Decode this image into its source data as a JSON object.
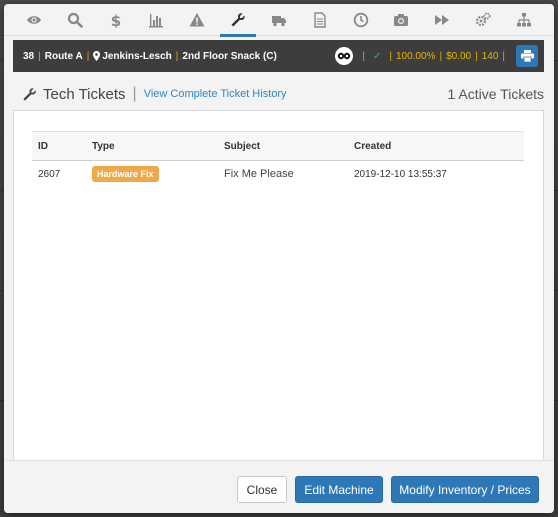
{
  "nav": {
    "icons": [
      "eye-icon",
      "search-icon",
      "dollar-icon",
      "bar-chart-icon",
      "warning-icon",
      "wrench-icon",
      "truck-icon",
      "document-icon",
      "clock-icon",
      "camera-icon",
      "fast-forward-icon",
      "gears-icon",
      "sitemap-icon"
    ],
    "active": "wrench-icon"
  },
  "machine": {
    "id": "38",
    "route": "Route A",
    "location": "Jenkins-Lesch",
    "name": "2nd Floor Snack (C)",
    "percent": "100.00%",
    "amount": "$0.00",
    "count": "140"
  },
  "header": {
    "title": "Tech Tickets",
    "history_link": "View Complete Ticket History",
    "active_count": "1 Active Tickets"
  },
  "table": {
    "columns": [
      "ID",
      "Type",
      "Subject",
      "Created"
    ],
    "rows": [
      {
        "id": "2607",
        "type": "Hardware Fix",
        "subject": "Fix Me Please",
        "created": "2019-12-10 13:55:37"
      }
    ]
  },
  "footer": {
    "close_label": "Close",
    "edit_label": "Edit Machine",
    "modify_label": "Modify Inventory / Prices"
  },
  "colors": {
    "accent": "#2f78b7",
    "badge": "#f0a94a",
    "bar_bg": "#3d3d3d",
    "gold": "#e6b800"
  }
}
